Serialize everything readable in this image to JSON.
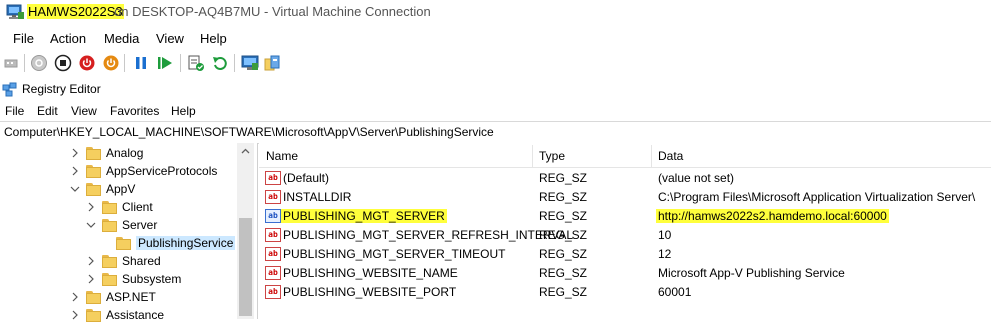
{
  "vm_window": {
    "host_name": "HAMWS2022S3",
    "title_rest": "on DESKTOP-AQ4B7MU - Virtual Machine Connection",
    "menu": [
      "File",
      "Action",
      "Media",
      "View",
      "Help"
    ],
    "toolbar_icons": [
      "ctrl-alt-del-icon",
      "start-icon",
      "turn-off-icon",
      "shut-down-icon",
      "save-icon",
      "pause-icon",
      "reset-icon",
      "checkpoint-icon",
      "revert-icon",
      "enhanced-session-icon",
      "share-icon"
    ]
  },
  "registry": {
    "title": "Registry Editor",
    "menu": [
      "File",
      "Edit",
      "View",
      "Favorites",
      "Help"
    ],
    "address": "Computer\\HKEY_LOCAL_MACHINE\\SOFTWARE\\Microsoft\\AppV\\Server\\PublishingService",
    "tree": [
      {
        "label": "Analog",
        "expanded": false
      },
      {
        "label": "AppServiceProtocols",
        "expanded": false
      },
      {
        "label": "AppV",
        "expanded": true
      },
      {
        "label": "Client",
        "expanded": false
      },
      {
        "label": "Server",
        "expanded": true
      },
      {
        "label": "PublishingService",
        "selected": true
      },
      {
        "label": "Shared",
        "expanded": false
      },
      {
        "label": "Subsystem",
        "expanded": false
      },
      {
        "label": "ASP.NET",
        "expanded": false
      },
      {
        "label": "Assistance",
        "expanded": false
      }
    ],
    "columns": {
      "name": "Name",
      "type": "Type",
      "data": "Data"
    },
    "values": [
      {
        "icon": "ab",
        "name": "(Default)",
        "type": "REG_SZ",
        "data": "(value not set)"
      },
      {
        "icon": "ab",
        "name": "INSTALLDIR",
        "type": "REG_SZ",
        "data": "C:\\Program Files\\Microsoft Application Virtualization Server\\"
      },
      {
        "icon": "ab",
        "name": "PUBLISHING_MGT_SERVER",
        "type": "REG_SZ",
        "data": "http://hamws2022s2.hamdemo.local:60000",
        "highlighted": true
      },
      {
        "icon": "ab",
        "name": "PUBLISHING_MGT_SERVER_REFRESH_INTERVAL",
        "type": "REG_SZ",
        "data": "10"
      },
      {
        "icon": "ab",
        "name": "PUBLISHING_MGT_SERVER_TIMEOUT",
        "type": "REG_SZ",
        "data": "12"
      },
      {
        "icon": "ab",
        "name": "PUBLISHING_WEBSITE_NAME",
        "type": "REG_SZ",
        "data": "Microsoft App-V Publishing Service"
      },
      {
        "icon": "ab",
        "name": "PUBLISHING_WEBSITE_PORT",
        "type": "REG_SZ",
        "data": "60001"
      }
    ],
    "highlight_color": "#ffff3c",
    "selection_color": "#cce8ff"
  }
}
